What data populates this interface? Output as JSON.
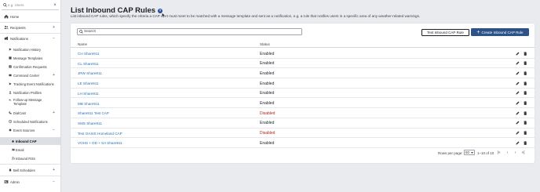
{
  "sidebar": {
    "search_placeholder": "e.g. Users",
    "clear_icon": "×",
    "items": [
      {
        "label": "Home",
        "icon": "home-icon",
        "expand": ""
      },
      {
        "label": "Recipients",
        "icon": "users-icon",
        "expand": "+"
      },
      {
        "label": "Notifications",
        "icon": "megaphone-icon",
        "expand": "−"
      },
      {
        "label": "Notification History",
        "icon": "play-icon",
        "expand": ""
      },
      {
        "label": "Message Templates",
        "icon": "template-icon",
        "expand": ""
      },
      {
        "label": "Confirmation Requests",
        "icon": "checklist-icon",
        "expand": ""
      },
      {
        "label": "Command Center",
        "icon": "command-icon",
        "expand": "+"
      },
      {
        "label": "Tracking Event Notifications",
        "icon": "play-icon",
        "expand": ""
      },
      {
        "label": "Notification Profiles",
        "icon": "profile-icon",
        "expand": ""
      },
      {
        "label": "Follow-up Message Template",
        "icon": "reply-icon",
        "expand": ""
      },
      {
        "label": "DialCast",
        "icon": "phone-icon",
        "expand": "+"
      },
      {
        "label": "Scheduled Notifications",
        "icon": "schedule-icon",
        "expand": ""
      },
      {
        "label": "Event Sources",
        "icon": "source-icon",
        "expand": "−"
      },
      {
        "label": "Inbound CAP",
        "icon": "dot-icon",
        "expand": ""
      },
      {
        "label": "Email",
        "icon": "mail-icon",
        "expand": ""
      },
      {
        "label": "Inbound RSS",
        "icon": "rss-icon",
        "expand": ""
      },
      {
        "label": "Bell Schedules",
        "icon": "bell-icon",
        "expand": "+"
      },
      {
        "label": "Admin",
        "icon": "admin-icon",
        "expand": "−"
      }
    ]
  },
  "header": {
    "title": "List Inbound CAP Rules",
    "help_icon": "?",
    "subtitle": "List inbound CAP rules, which specify the criteria a CAP alert must meet to be matched with a message template and sent as a notification, e.g. a rule that notifies users in a specific area of any weather-related warnings."
  },
  "toolbar": {
    "search_placeholder": "Search",
    "test_button": "Test Inbound CAP Rule",
    "create_button": "Create Inbound CAP Rule",
    "create_plus": "+"
  },
  "table": {
    "columns": [
      "Name",
      "Status"
    ],
    "rows": [
      {
        "name": "CH Share911",
        "status": "Enabled"
      },
      {
        "name": "CL Share911",
        "status": "Enabled"
      },
      {
        "name": "JRW Share911",
        "status": "Enabled"
      },
      {
        "name": "LE Share911",
        "status": "Enabled"
      },
      {
        "name": "LH Share911",
        "status": "Enabled"
      },
      {
        "name": "MB Share911",
        "status": "Enabled"
      },
      {
        "name": "Share911 Test CAP",
        "status": "Disabled"
      },
      {
        "name": "SMS Share911",
        "status": "Enabled"
      },
      {
        "name": "Test OASIS Homeland CAP",
        "status": "Disabled"
      },
      {
        "name": "VOHS + DD + SA Share911",
        "status": "Enabled"
      }
    ]
  },
  "pagination": {
    "rows_per_page_label": "Rows per page:",
    "rows_per_page_value": "50",
    "range": "1–10 of 10",
    "first": "|«",
    "prev": "‹",
    "next": "›",
    "last": "»|"
  },
  "colors": {
    "primary": "#2c5288",
    "link": "#2b6fb5",
    "disabled": "#b3261e"
  }
}
